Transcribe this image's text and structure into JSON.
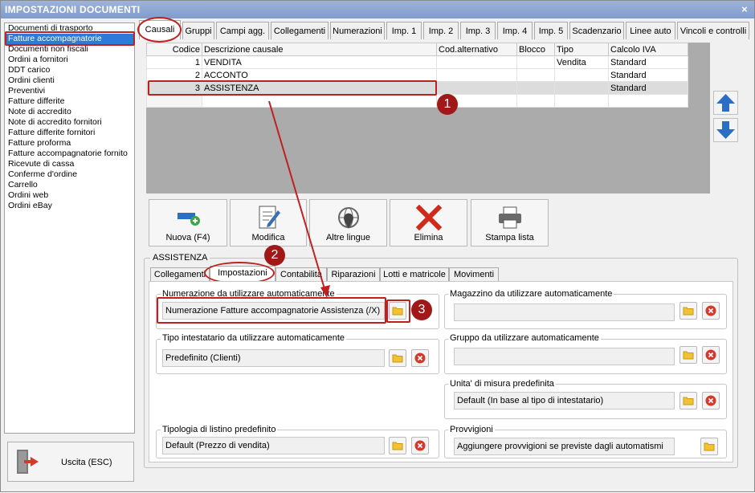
{
  "window": {
    "title": "IMPOSTAZIONI DOCUMENTI",
    "close": "×"
  },
  "left_list": [
    "Documenti di trasporto",
    "Fatture accompagnatorie",
    "Documenti non fiscali",
    "Ordini a fornitori",
    "DDT carico",
    "Ordini clienti",
    "Preventivi",
    "Fatture differite",
    "Note di accredito",
    "Note di accredito fornitori",
    "Fatture differite fornitori",
    "Fatture proforma",
    "Fatture accompagnatorie fornito",
    "Ricevute di cassa",
    "Conferme d'ordine",
    "Carrello",
    "Ordini web",
    "Ordini eBay"
  ],
  "exit_label": "Uscita (ESC)",
  "tabs": [
    "Causali",
    "Gruppi",
    "Campi agg.",
    "Collegamenti",
    "Numerazioni",
    "Imp. 1",
    "Imp. 2",
    "Imp. 3",
    "Imp. 4",
    "Imp. 5",
    "Scadenzario",
    "Linee auto",
    "Vincoli e controlli"
  ],
  "grid": {
    "headers": [
      "Codice",
      "Descrizione causale",
      "Cod.alternativo",
      "Blocco",
      "Tipo",
      "Calcolo IVA"
    ],
    "rows": [
      [
        "1",
        "VENDITA",
        "",
        "",
        "Vendita",
        "Standard"
      ],
      [
        "2",
        "ACCONTO",
        "",
        "",
        "",
        "Standard"
      ],
      [
        "3",
        "ASSISTENZA",
        "",
        "",
        "",
        "Standard"
      ]
    ]
  },
  "toolbar": [
    "Nuova (F4)",
    "Modifica",
    "Altre lingue",
    "Elimina",
    "Stampa lista"
  ],
  "group_title": "ASSISTENZA",
  "subtabs": [
    "Collegamenti",
    "Impostazioni",
    "Contabilita",
    "Riparazioni",
    "Lotti e matricole",
    "Movimenti"
  ],
  "fields": {
    "numerazione": {
      "label": "Numerazione da utilizzare automaticamente",
      "value": "Numerazione Fatture accompagnatorie Assistenza (/X)"
    },
    "intestatario": {
      "label": "Tipo intestatario da utilizzare automaticamente",
      "value": "Predefinito (Clienti)"
    },
    "listino": {
      "label": "Tipologia di listino predefinito",
      "value": "Default (Prezzo di vendita)"
    },
    "magazzino": {
      "label": "Magazzino da utilizzare automaticamente",
      "value": ""
    },
    "gruppo": {
      "label": "Gruppo da utilizzare automaticamente",
      "value": ""
    },
    "unita": {
      "label": "Unita' di misura predefinita",
      "value": "Default (In base al tipo di intestatario)"
    },
    "provvigioni": {
      "label": "Provvigioni",
      "value": "Aggiungere provvigioni se previste dagli automatismi"
    }
  },
  "badges": [
    "1",
    "2",
    "3"
  ],
  "colors": {
    "annotation": "#c02020",
    "selection": "#2d7bd6",
    "titlebar": "#7f9ccc"
  }
}
